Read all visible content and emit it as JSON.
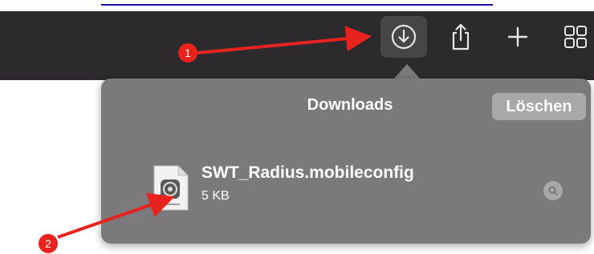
{
  "toolbar": {
    "buttons": [
      {
        "name": "downloads",
        "icon": "download-icon",
        "active": true
      },
      {
        "name": "share",
        "icon": "share-icon"
      },
      {
        "name": "new-tab",
        "icon": "plus-icon"
      },
      {
        "name": "tab-overview",
        "icon": "grid-icon"
      }
    ]
  },
  "downloads": {
    "title": "Downloads",
    "clear_label": "Löschen",
    "items": [
      {
        "filename": "SWT_Radius.mobileconfig",
        "size": "5 KB",
        "icon": "config-file-icon",
        "action_icon": "magnifier-icon"
      }
    ]
  },
  "annotations": [
    {
      "label": "1",
      "color": "#e8231e"
    },
    {
      "label": "2",
      "color": "#e8231e"
    }
  ],
  "colors": {
    "toolbar_bg": "#2c2a2c",
    "popover_bg": "#7b797b",
    "annotation_red": "#e8231e"
  }
}
